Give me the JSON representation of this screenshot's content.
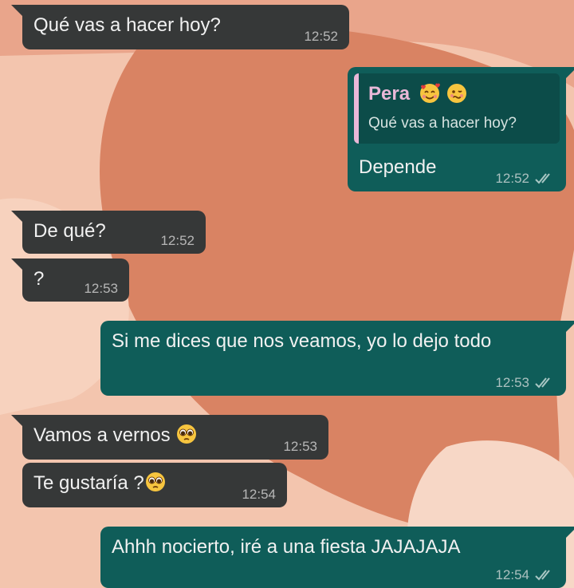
{
  "colors": {
    "incoming_bubble": "#363838",
    "outgoing_bubble": "#0f5d59",
    "quote_accent": "#e9b8d8",
    "wallpaper_light": "#f3c5ae",
    "wallpaper_dark": "#d98363"
  },
  "messages": [
    {
      "direction": "incoming",
      "text": "Qué vas a hacer hoy?",
      "time": "12:52"
    },
    {
      "direction": "outgoing",
      "text": "Depende",
      "time": "12:52",
      "status_icon": "double-check-icon",
      "reply_to": {
        "sender": "Pera",
        "sender_emojis": [
          "smiling-face-with-hearts-emoji",
          "woozy-face-emoji"
        ],
        "text": "Qué vas a hacer hoy?"
      }
    },
    {
      "direction": "incoming",
      "text": "De qué?",
      "time": "12:52"
    },
    {
      "direction": "incoming",
      "text": "?",
      "time": "12:53"
    },
    {
      "direction": "outgoing",
      "text": "Si me dices que nos veamos, yo lo dejo todo",
      "time": "12:53",
      "status_icon": "double-check-icon"
    },
    {
      "direction": "incoming",
      "text": "Vamos a vernos",
      "emoji": "pleading-face-emoji",
      "time": "12:53"
    },
    {
      "direction": "incoming",
      "text": "Te gustaría ?",
      "emoji": "pleading-face-emoji",
      "time": "12:54"
    },
    {
      "direction": "outgoing",
      "text": "Ahhh nocierto, iré a una fiesta JAJAJAJA",
      "time": "12:54",
      "status_icon": "double-check-icon"
    }
  ]
}
